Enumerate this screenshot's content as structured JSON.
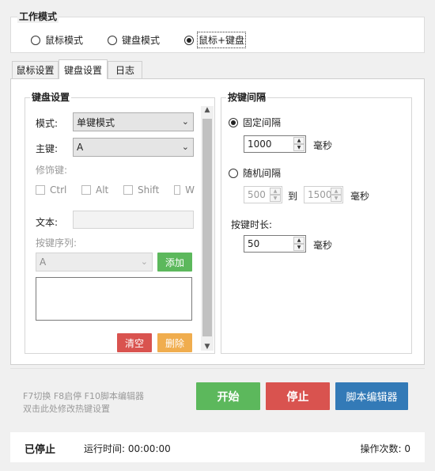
{
  "work_mode": {
    "title": "工作模式",
    "options": [
      {
        "label": "鼠标模式",
        "selected": false
      },
      {
        "label": "键盘模式",
        "selected": false
      },
      {
        "label": "鼠标+键盘",
        "selected": true
      }
    ]
  },
  "tabs": [
    {
      "label": "鼠标设置",
      "active": false
    },
    {
      "label": "键盘设置",
      "active": true
    },
    {
      "label": "日志",
      "active": false
    }
  ],
  "keyboard_settings": {
    "title": "键盘设置",
    "mode_label": "模式:",
    "mode_value": "单键模式",
    "key_label": "主键:",
    "key_value": "A",
    "modifier_label": "修饰键:",
    "modifiers": [
      "Ctrl",
      "Alt",
      "Shift",
      "W"
    ],
    "text_label": "文本:",
    "text_value": "",
    "sequence_label": "按键序列:",
    "sequence_key_value": "A",
    "add_button": "添加",
    "clear_button": "清空",
    "delete_button": "删除"
  },
  "key_interval": {
    "title": "按键间隔",
    "fixed_label": "固定间隔",
    "fixed_selected": true,
    "fixed_value": "1000",
    "ms_unit": "毫秒",
    "random_label": "随机间隔",
    "random_selected": false,
    "random_min": "500",
    "to_label": "到",
    "random_max": "1500",
    "duration_label": "按键时长:",
    "duration_value": "50"
  },
  "hotkeys": {
    "line1": "F7切换 F8启停 F10脚本编辑器",
    "line2": "双击此处修改热键设置",
    "start_button": "开始",
    "stop_button": "停止",
    "script_editor_button": "脚本编辑器"
  },
  "status": {
    "state": "已停止",
    "runtime": "运行时间: 00:00:00",
    "count": "操作次数: 0"
  },
  "colors": {
    "green": "#5cb85c",
    "red": "#d9534f",
    "orange": "#f0ad4e",
    "blue": "#337ab7"
  }
}
